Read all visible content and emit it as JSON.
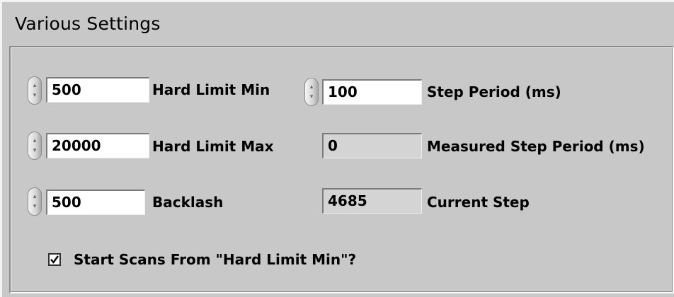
{
  "panel": {
    "title": "Various Settings"
  },
  "controls": {
    "hard_limit_min": {
      "value": "500",
      "label": "Hard Limit Min"
    },
    "hard_limit_max": {
      "value": "20000",
      "label": "Hard Limit Max"
    },
    "backlash": {
      "value": "500",
      "label": "Backlash"
    },
    "step_period": {
      "value": "100",
      "label": "Step Period (ms)"
    }
  },
  "indicators": {
    "measured_step_period": {
      "value": "0",
      "label": "Measured Step Period (ms)"
    },
    "current_step": {
      "value": "4685",
      "label": "Current Step"
    }
  },
  "start_scans": {
    "label": "Start Scans From \"Hard Limit Min\"?",
    "checked": true
  },
  "icons": {
    "spin": "increment-decrement-arrows-icon",
    "check": "checkmark-icon"
  }
}
